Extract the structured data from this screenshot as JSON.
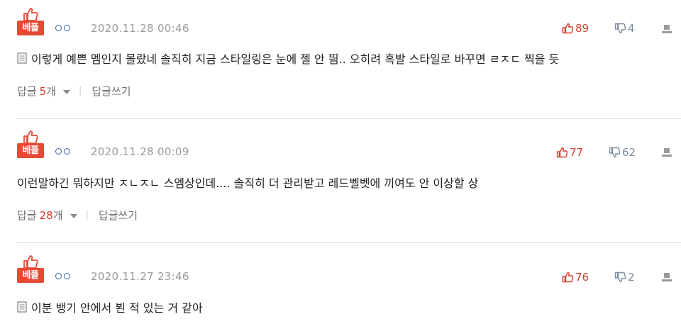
{
  "badge_label": "베플",
  "nick_mask": "",
  "comments": [
    {
      "date": "2020.11.28 00:46",
      "text": "이렇게 예쁜 멤인지 몰랐네 솔직히 지금 스타일링은 눈에 젤 안 띔.. 오히려 흑발 스타일로 바꾸면 ㄹㅈㄷ 찍을 듯",
      "has_doc_icon": true,
      "likes": "89",
      "dislikes": "4",
      "reply_label": "답글",
      "reply_count": "5",
      "reply_suffix": "개",
      "write_label": "답글쓰기"
    },
    {
      "date": "2020.11.28 00:09",
      "text": "이런말하긴 뭐하지만 ㅈㄴㅈㄴ 스엠상인데.... 솔직히 더 관리받고 레드벨벳에 끼여도 안 이상할 상",
      "has_doc_icon": false,
      "likes": "77",
      "dislikes": "62",
      "reply_label": "답글",
      "reply_count": "28",
      "reply_suffix": "개",
      "write_label": "답글쓰기"
    },
    {
      "date": "2020.11.27 23:46",
      "text": "이분 뱅기 안에서 뵌 적 있는 거 같아",
      "has_doc_icon": true,
      "likes": "76",
      "dislikes": "2"
    }
  ],
  "separator": "|",
  "colors": {
    "badge": "#e64a35",
    "like": "#d53b2b",
    "dislike": "#7d8d9c",
    "date": "#9a9a9a"
  },
  "icons": {
    "best": "thumbs-up-icon",
    "like": "thumbs-up-icon",
    "dislike": "thumbs-down-icon",
    "report": "report-icon",
    "doc": "document-icon",
    "caret": "caret-down-icon"
  }
}
